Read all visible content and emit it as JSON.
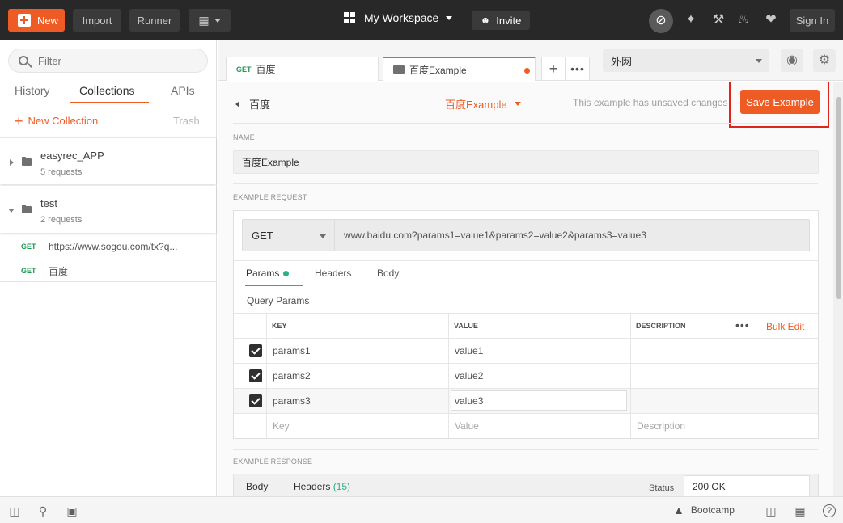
{
  "header": {
    "new_label": "New",
    "import_label": "Import",
    "runner_label": "Runner",
    "workspace_label": "My Workspace",
    "invite_label": "Invite",
    "signin_label": "Sign In"
  },
  "sidebar": {
    "filter_placeholder": "Filter",
    "tabs": [
      "History",
      "Collections",
      "APIs"
    ],
    "new_collection_label": "New Collection",
    "trash_label": "Trash",
    "collections": [
      {
        "name": "easyrec_APP",
        "count": "5 requests"
      },
      {
        "name": "test",
        "count": "2 requests"
      }
    ],
    "requests": [
      {
        "method": "GET",
        "url": "https://www.sogou.com/tx?q..."
      },
      {
        "method": "GET",
        "url": "百度"
      }
    ]
  },
  "tabs": [
    {
      "method": "GET",
      "label": "百度"
    },
    {
      "label": "百度Example"
    }
  ],
  "environment": {
    "selected": "外网"
  },
  "example": {
    "back_label": "百度",
    "name_dropdown": "百度Example",
    "unsaved_note": "This example has unsaved changes",
    "save_label": "Save Example",
    "name_section": "NAME",
    "name_value": "百度Example",
    "request_section": "EXAMPLE REQUEST",
    "method": "GET",
    "url": "www.baidu.com?params1=value1&params2=value2&params3=value3",
    "request_tabs": [
      "Params",
      "Headers",
      "Body"
    ],
    "query_params_label": "Query Params",
    "columns": {
      "key": "KEY",
      "value": "VALUE",
      "description": "DESCRIPTION"
    },
    "bulk_edit_label": "Bulk Edit",
    "params": [
      {
        "key": "params1",
        "value": "value1"
      },
      {
        "key": "params2",
        "value": "value2"
      },
      {
        "key": "params3",
        "value": "value3"
      }
    ],
    "placeholders": {
      "key": "Key",
      "value": "Value",
      "description": "Description"
    },
    "response_section": "EXAMPLE RESPONSE",
    "response_tabs": {
      "body": "Body",
      "headers": "Headers",
      "headers_count": "(15)"
    },
    "status_label": "Status",
    "status_value": "200 OK"
  },
  "footer": {
    "bootcamp_label": "Bootcamp"
  },
  "colors": {
    "accent": "#ef5b25",
    "get_method": "#1a9a52",
    "highlight": "#e0231b"
  }
}
